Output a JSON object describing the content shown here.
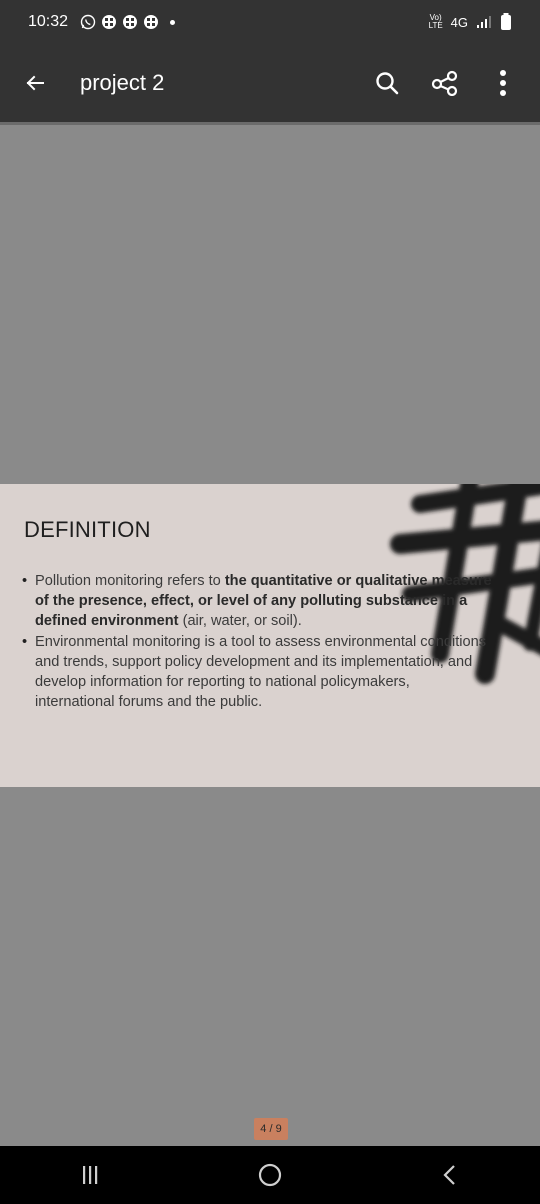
{
  "status": {
    "time": "10:32",
    "volte_top": "Vo)",
    "volte_bottom": "LTE",
    "network": "4G"
  },
  "appbar": {
    "title": "project 2",
    "icons": [
      "arrow-back-icon",
      "search-icon",
      "share-icon",
      "more-vert-icon"
    ]
  },
  "slide": {
    "heading": "DEFINITION",
    "bullets": [
      {
        "t1": "Pollution monitoring refers to ",
        "b1": "the quantitative or qualitative measure of the presence, effect, or level of any polluting substance in a defined environment",
        "t2": " (air, water, or soil)."
      },
      {
        "text": "Environmental monitoring is a tool to assess environmental conditions and trends, support policy development and its implementation, and develop information for reporting to national policymakers, international forums and the public."
      }
    ]
  },
  "page_indicator": "4 / 9",
  "colors": {
    "bar_bg": "#333333",
    "page_bg": "#8a8a8a",
    "slide_bg": "#dad2cf",
    "indicator_bg": "#c9805f"
  }
}
